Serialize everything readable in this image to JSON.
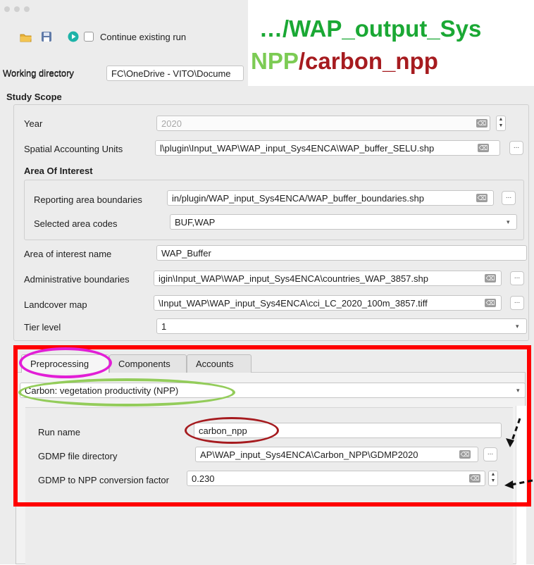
{
  "toolbar": {
    "continue_label": "Continue existing run"
  },
  "working_directory": {
    "label": "Working directory",
    "value": "FC\\OneDrive - VITO\\Docume"
  },
  "overlay": {
    "prefix": "…/",
    "folder": "WAP_output_Sys",
    "line2_a": "NPP",
    "line2_sep": "/",
    "line2_b": "carbon_npp",
    "colors": {
      "green_dark": "#1aa834",
      "green_light": "#7ccb54",
      "dark_red": "#a61b1f",
      "highlight_red": "#ff0000",
      "magenta": "#e21ed6",
      "ellipse_green": "#93cc5a"
    }
  },
  "study_scope": {
    "title": "Study Scope",
    "year_label": "Year",
    "year_value": "2020",
    "sau_label": "Spatial Accounting Units",
    "sau_value": "l\\plugin\\Input_WAP\\WAP_input_Sys4ENCA\\WAP_buffer_SELU.shp",
    "aoi_title": "Area Of Interest",
    "rab_label": "Reporting area boundaries",
    "rab_value": "in/plugin/WAP_input_Sys4ENCA/WAP_buffer_boundaries.shp",
    "codes_label": "Selected area codes",
    "codes_value": "BUF,WAP",
    "aoi_name_label": "Area of interest name",
    "aoi_name_value": "WAP_Buffer",
    "admin_label": "Administrative boundaries",
    "admin_value": "igin\\Input_WAP\\WAP_input_Sys4ENCA\\countries_WAP_3857.shp",
    "landcover_label": "Landcover map",
    "landcover_value": "\\Input_WAP\\WAP_input_Sys4ENCA\\cci_LC_2020_100m_3857.tiff",
    "tier_label": "Tier level",
    "tier_value": "1"
  },
  "tabs": [
    "Preprocessing",
    "Components",
    "Accounts"
  ],
  "preprocessing": {
    "dropdown_value": "Carbon: vegetation productivity (NPP)",
    "run_name_label": "Run name",
    "run_name_value": "carbon_npp",
    "gdmp_dir_label": "GDMP file directory",
    "gdmp_dir_value": "AP\\WAP_input_Sys4ENCA\\Carbon_NPP\\GDMP2020",
    "factor_label": "GDMP to NPP conversion factor",
    "factor_value": "0.230"
  },
  "icons": {
    "clear": "⌫",
    "browse": "...",
    "combo": "▾",
    "spin_up": "▲",
    "spin_down": "▼"
  }
}
